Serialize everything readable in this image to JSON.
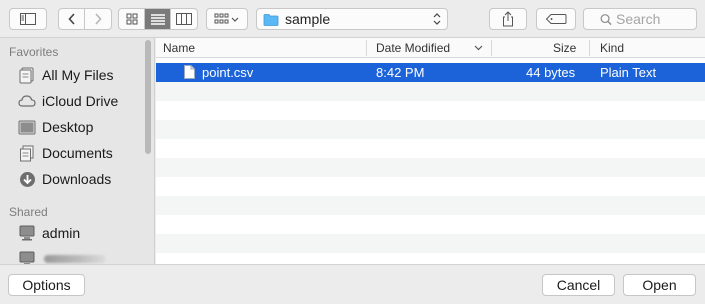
{
  "toolbar": {
    "path_label": "sample",
    "search_placeholder": "Search",
    "icons": [
      "sidebar-toggle-icon",
      "back-chevron-icon",
      "forward-chevron-icon",
      "icon-view-icon",
      "list-view-icon",
      "column-view-icon",
      "arrange-grid-icon",
      "folder-icon",
      "share-icon",
      "tag-icon",
      "magnifier-icon"
    ]
  },
  "sidebar": {
    "favorites_header": "Favorites",
    "favorites": [
      {
        "label": "All My Files",
        "icon": "all-files-icon"
      },
      {
        "label": "iCloud Drive",
        "icon": "cloud-icon"
      },
      {
        "label": "Desktop",
        "icon": "desktop-icon"
      },
      {
        "label": "Documents",
        "icon": "documents-icon"
      },
      {
        "label": "Downloads",
        "icon": "downloads-icon"
      }
    ],
    "shared_header": "Shared",
    "shared": [
      {
        "label": "admin",
        "icon": "computer-icon"
      }
    ]
  },
  "filelist": {
    "columns": {
      "name": "Name",
      "date": "Date Modified",
      "size": "Size",
      "kind": "Kind"
    },
    "rows": [
      {
        "name": "point.csv",
        "date": "8:42 PM",
        "size": "44 bytes",
        "kind": "Plain Text",
        "selected": true
      }
    ]
  },
  "bottombar": {
    "options": "Options",
    "cancel": "Cancel",
    "open": "Open"
  },
  "colors": {
    "selection": "#1c63d9",
    "folder": "#5ab8f5"
  }
}
